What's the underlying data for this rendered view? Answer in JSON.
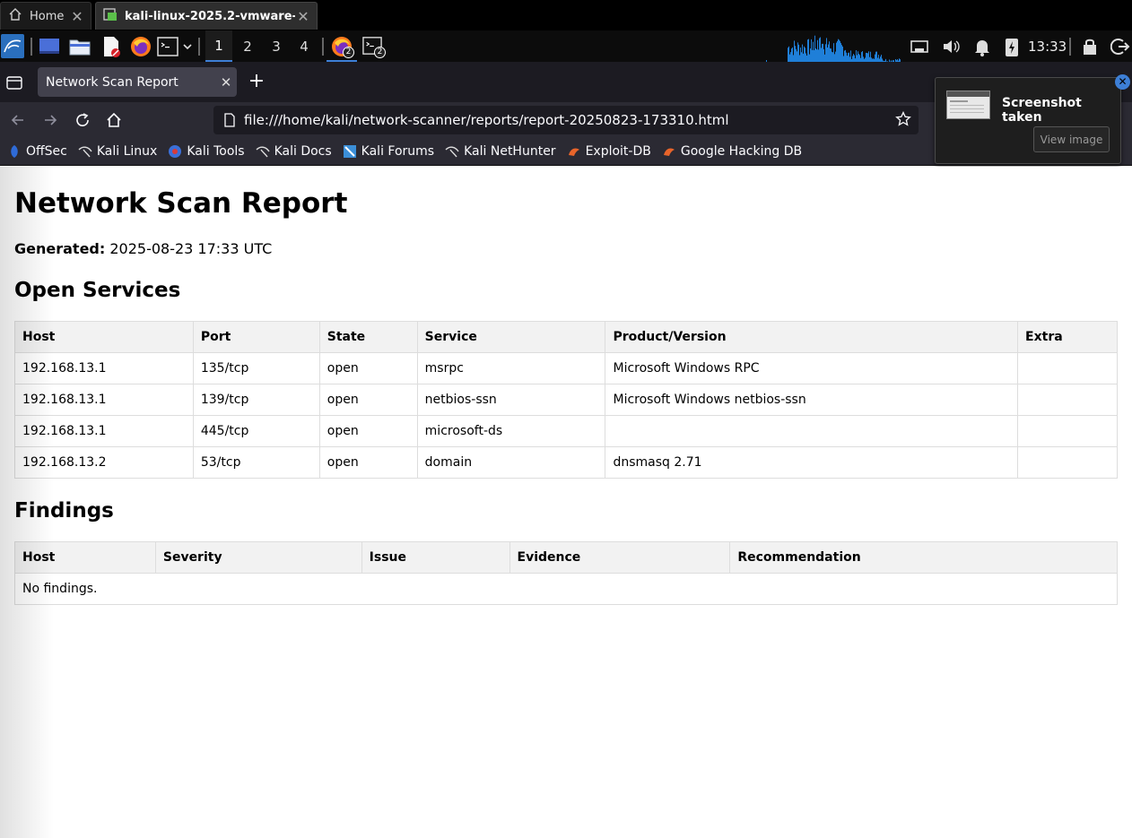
{
  "vm_tabs": {
    "home_label": "Home",
    "vm_label": "kali-linux-2025.2-vmware-a..."
  },
  "panel": {
    "workspaces": [
      "1",
      "2",
      "3",
      "4"
    ],
    "active_workspace": "1",
    "firefox_badge": "2",
    "terminal_badge": "2",
    "clock": "13:33"
  },
  "browser": {
    "tab_title": "Network Scan Report",
    "url": "file:///home/kali/network-scanner/reports/report-20250823-173310.html",
    "bookmarks": [
      {
        "label": "OffSec",
        "icon": "offsec-icon"
      },
      {
        "label": "Kali Linux",
        "icon": "kali-dragon-icon"
      },
      {
        "label": "Kali Tools",
        "icon": "kali-tools-icon"
      },
      {
        "label": "Kali Docs",
        "icon": "kali-dragon-icon"
      },
      {
        "label": "Kali Forums",
        "icon": "kali-forums-icon"
      },
      {
        "label": "Kali NetHunter",
        "icon": "kali-dragon-icon"
      },
      {
        "label": "Exploit-DB",
        "icon": "exploit-db-icon"
      },
      {
        "label": "Google Hacking DB",
        "icon": "exploit-db-icon"
      }
    ]
  },
  "notification": {
    "title": "Screenshot taken",
    "button": "View image"
  },
  "report": {
    "title": "Network Scan Report",
    "generated_label": "Generated:",
    "generated_value": "2025-08-23 17:33 UTC",
    "open_services": {
      "heading": "Open Services",
      "columns": [
        "Host",
        "Port",
        "State",
        "Service",
        "Product/Version",
        "Extra"
      ],
      "rows": [
        [
          "192.168.13.1",
          "135/tcp",
          "open",
          "msrpc",
          "Microsoft Windows RPC",
          ""
        ],
        [
          "192.168.13.1",
          "139/tcp",
          "open",
          "netbios-ssn",
          "Microsoft Windows netbios-ssn",
          ""
        ],
        [
          "192.168.13.1",
          "445/tcp",
          "open",
          "microsoft-ds",
          "",
          ""
        ],
        [
          "192.168.13.2",
          "53/tcp",
          "open",
          "domain",
          "dnsmasq 2.71",
          ""
        ]
      ]
    },
    "findings": {
      "heading": "Findings",
      "columns": [
        "Host",
        "Severity",
        "Issue",
        "Evidence",
        "Recommendation"
      ],
      "empty_text": "No findings."
    }
  },
  "colors": {
    "accent": "#3d7fd6",
    "browser_chrome": "#2b2a33",
    "table_header_bg": "#f2f2f2"
  }
}
